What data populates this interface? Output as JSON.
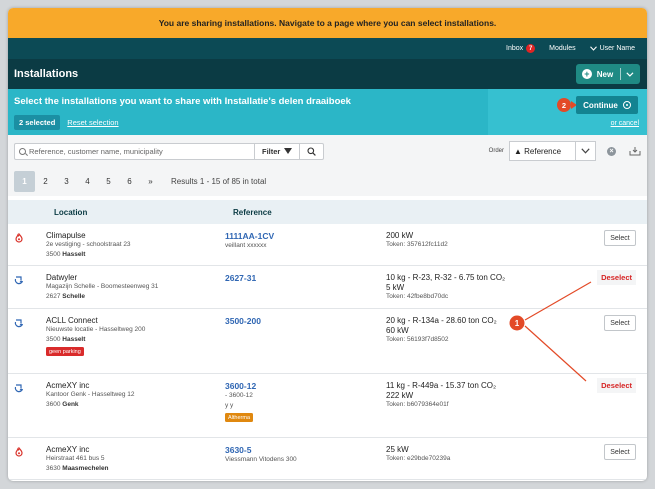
{
  "banner": {
    "text": "You are sharing installations. Navigate to a page where you can select installations."
  },
  "topbar": {
    "inbox_label": "Inbox",
    "inbox_count": "7",
    "modules_label": "Modules",
    "user_label": "User Name"
  },
  "header": {
    "title": "Installations",
    "new_label": "New"
  },
  "share": {
    "message": "Select the installations you want to share with Installatie's delen draaiboek",
    "selected_label": "2 selected",
    "reset_label": "Reset selection",
    "continue_label": "Continue",
    "cancel_label": "or cancel",
    "marker": "2"
  },
  "filter": {
    "search_placeholder": "Reference, customer name, municipality",
    "filter_label": "Filter",
    "order_label": "Order",
    "order_value": "▲ Reference"
  },
  "pagination": {
    "pages": [
      "1",
      "2",
      "3",
      "4",
      "5",
      "6",
      "»"
    ],
    "results": "Results 1 - 15 of 85 in total"
  },
  "table": {
    "columns": [
      "Location",
      "Reference"
    ],
    "rows": [
      {
        "icon": "boiler-icon",
        "name": "Climapulse",
        "addr1": "2e vestiging - schoolstraat 23",
        "zip": "3500",
        "city": "Hasselt",
        "ref": "1111AA-1CV",
        "ref_sub": [
          "veillant xxxxxx"
        ],
        "info": [
          "200 kW"
        ],
        "token": "Token: 357612fc11d2",
        "action": "Select",
        "tag": ""
      },
      {
        "icon": "heatpump-icon",
        "name": "Datwyler",
        "addr1": "Magazijn Schelle - Boomesteenweg 31",
        "zip": "2627",
        "city": "Schelle",
        "ref": "2627-31",
        "ref_sub": [],
        "info": [
          "10 kg - R-23, R-32 - 6.75 ton CO₂",
          "5 kW"
        ],
        "token": "Token: 42fbe8bd70dc",
        "action": "Deselect",
        "tag": ""
      },
      {
        "icon": "heatpump-icon",
        "name": "ACLL Connect",
        "addr1": "Nieuwste locatie - Hasseltweg 200",
        "zip": "3500",
        "city": "Hasselt",
        "ref": "3500-200",
        "ref_sub": [],
        "info": [
          "20 kg - R-134a - 28.60 ton CO₂",
          "60 kW"
        ],
        "token": "Token: 56193f7d8502",
        "action": "Select",
        "tag": "geen parking",
        "tag_color": "#d92b2b"
      },
      {
        "icon": "heatpump-icon",
        "name": "AcmeXY inc",
        "addr1": "Kantoor Genk - Hasseltweg 12",
        "zip": "3600",
        "city": "Genk",
        "ref": "3600-12",
        "ref_sub": [
          "- 3600-12",
          "y y"
        ],
        "info": [
          "11 kg - R-449a - 15.37 ton CO₂",
          "222 kW"
        ],
        "token": "Token: b6079364e01f",
        "action": "Deselect",
        "tag": "Altherma",
        "tag_color": "#e0880f",
        "tag_in_ref": true
      },
      {
        "icon": "boiler-icon",
        "name": "AcmeXY inc",
        "addr1": "Heirstraat 461 bus 5",
        "zip": "3630",
        "city": "Maasmechelen",
        "ref": "3630-5",
        "ref_sub": [
          "Viessmann Vitodens 300"
        ],
        "info": [
          "25 kW"
        ],
        "token": "Token: e29bde70239a",
        "action": "Select",
        "tag": ""
      }
    ]
  },
  "annotation": {
    "marker": "1",
    "color": "#e34a27"
  }
}
